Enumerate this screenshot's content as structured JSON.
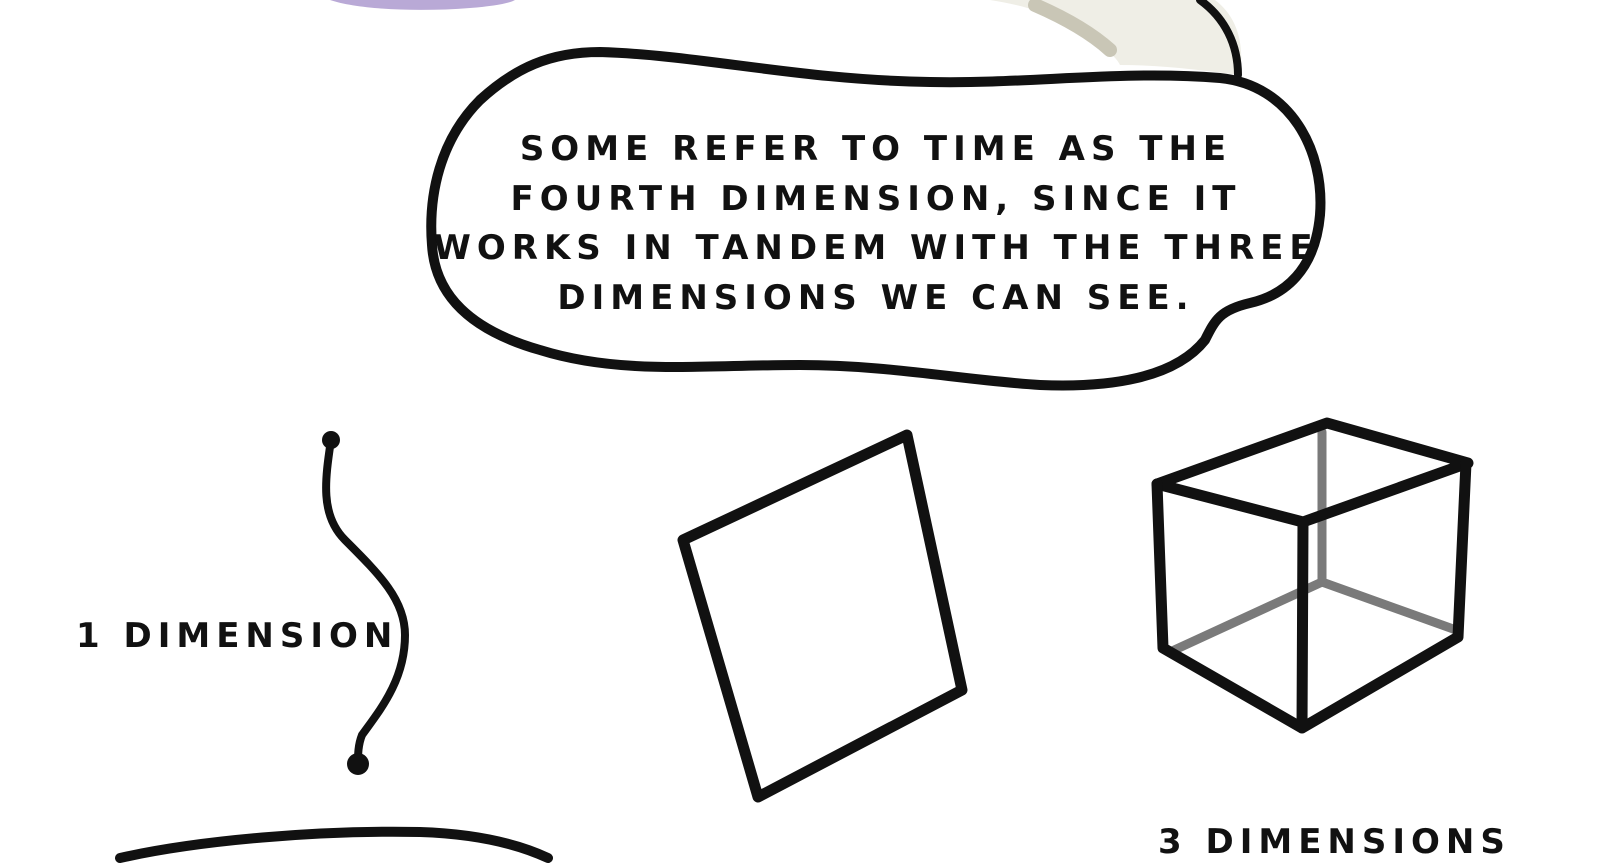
{
  "speech_bubble": {
    "lines": [
      "Some refer to time as the",
      "fourth dimension, since it",
      "works in tandem with the three",
      "dimensions we can see."
    ]
  },
  "labels": {
    "one_dimension": "1 Dimension",
    "three_dimensions": "3 Dimensions"
  },
  "colors": {
    "ink": "#111111",
    "hidden_edges": "#7a7a7a",
    "purple_shape": "#b9a9d6",
    "beige_shape": "#efeee6",
    "beige_edge": "#c9c6b6",
    "background": "#ffffff"
  }
}
